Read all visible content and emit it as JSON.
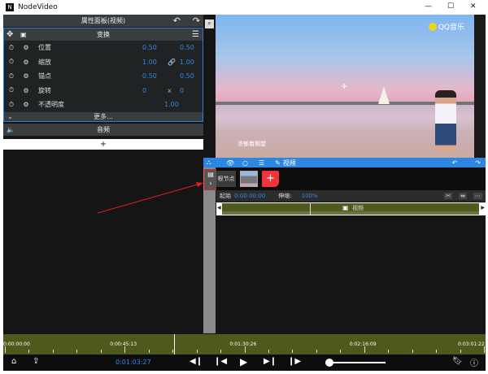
{
  "window": {
    "title": "NodeVideo",
    "minimize": "—",
    "maximize": "☐",
    "close": "✕"
  },
  "properties": {
    "title": "属性面板(视频)",
    "undo": "↶",
    "redo": "↷",
    "transform": {
      "title": "变换",
      "rows": [
        {
          "label": "位置",
          "v1": "0.50",
          "v2": "0.50",
          "mid": ""
        },
        {
          "label": "缩放",
          "v1": "1.00",
          "v2": "1.00",
          "mid": "🔗"
        },
        {
          "label": "锚点",
          "v1": "0.50",
          "v2": "0.50",
          "mid": ""
        },
        {
          "label": "旋转",
          "v1": "0",
          "v2": "0",
          "mid": "x"
        },
        {
          "label": "不透明度",
          "v1": "",
          "v2": "1.00",
          "mid": ""
        }
      ],
      "more": "更多..."
    },
    "audio": "音频",
    "add": "+"
  },
  "preview": {
    "watermark": "QQ音乐",
    "subtitle": "浓郁着期望"
  },
  "toolbar": {
    "label": "视频"
  },
  "keyframes": {
    "node_label": "根节点",
    "add": "+"
  },
  "clip_info": {
    "start_label": "起始",
    "start": "0:00:00:00",
    "stretch_label": "伸缩:",
    "stretch": "100%"
  },
  "track": {
    "label": "视频"
  },
  "timeline": {
    "ticks": [
      "0:00:00:00",
      "0:00:45:13",
      "0:01:30:26",
      "0:02:16:09",
      "0:03:01:22"
    ],
    "current": "0:01:03:27",
    "playhead_fraction": 0.35,
    "zoom_fraction": 0.02
  },
  "colors": {
    "accent": "#2e8ae6",
    "timeline": "#4d5a1c",
    "add": "#f0353c"
  }
}
